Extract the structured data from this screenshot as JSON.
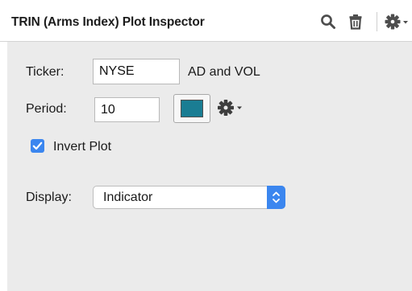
{
  "header": {
    "title": "TRIN (Arms Index) Plot Inspector",
    "icons": [
      "search-icon",
      "trash-icon",
      "gear-icon",
      "dropdown-caret-icon"
    ]
  },
  "form": {
    "ticker": {
      "label": "Ticker:",
      "value": "NYSE",
      "suffix": "AD and VOL"
    },
    "period": {
      "label": "Period:",
      "value": "10"
    },
    "color": {
      "value": "#1a7d93",
      "icons": [
        "gear-icon",
        "dropdown-caret-icon"
      ]
    },
    "invert_plot": {
      "label": "Invert Plot",
      "checked": true
    },
    "display": {
      "label": "Display:",
      "selected": "Indicator"
    }
  },
  "colors": {
    "accent": "#3b86ef",
    "panel_background": "#ebebeb",
    "header_background": "#ffffff"
  }
}
